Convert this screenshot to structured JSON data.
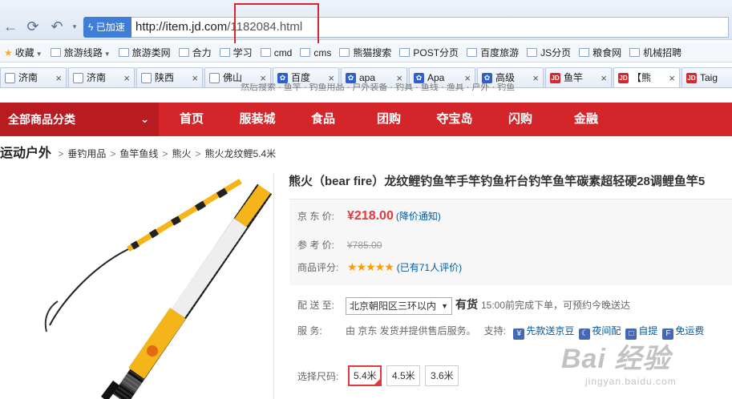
{
  "browser": {
    "accel_label": "已加速",
    "url_host": "http://item.jd.com",
    "url_path": "/1182084.html",
    "bookmarks": [
      {
        "label": "收藏",
        "has_caret": true
      },
      {
        "label": "旅游线路",
        "has_caret": true
      },
      {
        "label": "旅游类网"
      },
      {
        "label": "合力"
      },
      {
        "label": "学习"
      },
      {
        "label": "cmd"
      },
      {
        "label": "cms"
      },
      {
        "label": "熊猫搜索"
      },
      {
        "label": "POST分页"
      },
      {
        "label": "百度旅游"
      },
      {
        "label": "JS分页"
      },
      {
        "label": "粮食网"
      },
      {
        "label": "机械招聘"
      }
    ],
    "tabs": [
      {
        "label": "济南",
        "icon": "page"
      },
      {
        "label": "济南",
        "icon": "page"
      },
      {
        "label": "陕西",
        "icon": "page"
      },
      {
        "label": "佛山",
        "icon": "page"
      },
      {
        "label": "百度",
        "icon": "paw"
      },
      {
        "label": "apa",
        "icon": "paw"
      },
      {
        "label": "Apa",
        "icon": "paw"
      },
      {
        "label": "高级",
        "icon": "paw"
      },
      {
        "label": "鱼竿",
        "icon": "jd"
      },
      {
        "label": "【熊",
        "icon": "jd",
        "active": true
      },
      {
        "label": "Taig",
        "icon": "jd"
      }
    ]
  },
  "page": {
    "top_links": "然后搜索 · 鱼竿 · 钓鱼用品 · 户外装备 · 钓具 · 鱼线 · 渔具 · 户外 · 钓鱼",
    "cat_all": "全部商品分类",
    "nav_links": [
      "首页",
      "服装城",
      "食品",
      "团购",
      "夺宝岛",
      "闪购",
      "金融"
    ],
    "breadcrumb": {
      "root": "运动户外",
      "items": [
        "垂钓用品",
        "鱼竿鱼线",
        "熊火",
        "熊火龙纹鲤5.4米"
      ]
    },
    "product": {
      "title": "熊火（bear fire）龙纹鲤钓鱼竿手竿钓鱼杆台钓竿鱼竿碳素超轻硬28调鲤鱼竿5",
      "price_label": "京 东 价:",
      "price": "¥218.00",
      "price_notice": "(降价通知)",
      "ref_label": "参 考 价:",
      "ref_price": "¥785.00",
      "rating_label": "商品评分:",
      "rating_stars": 5,
      "rating_text": "(已有71人评价)",
      "ship_label": "配 送 至:",
      "ship_region": "北京朝阳区三环以内",
      "stock": "有货",
      "ship_note": "15:00前完成下单，可预约今晚送达",
      "service_label": "服    务:",
      "service_text": "由 京东 发货并提供售后服务。",
      "support_label": "支持:",
      "support_items": [
        {
          "icon_char": "¥",
          "label": "先款送京豆"
        },
        {
          "icon_char": "☾",
          "label": "夜间配"
        },
        {
          "icon_char": "□",
          "label": "自提"
        },
        {
          "icon_char": "F",
          "label": "免运费"
        }
      ],
      "size_label": "选择尺码:",
      "sizes": [
        {
          "label": "5.4米",
          "selected": true
        },
        {
          "label": "4.5米"
        },
        {
          "label": "3.6米"
        }
      ]
    },
    "watermark": {
      "main": "Bai 经验",
      "sub": "jingyan.baidu.com"
    }
  },
  "colors": {
    "jd_red": "#d4262a",
    "price_red": "#e4393c",
    "link_blue": "#005aa0"
  }
}
